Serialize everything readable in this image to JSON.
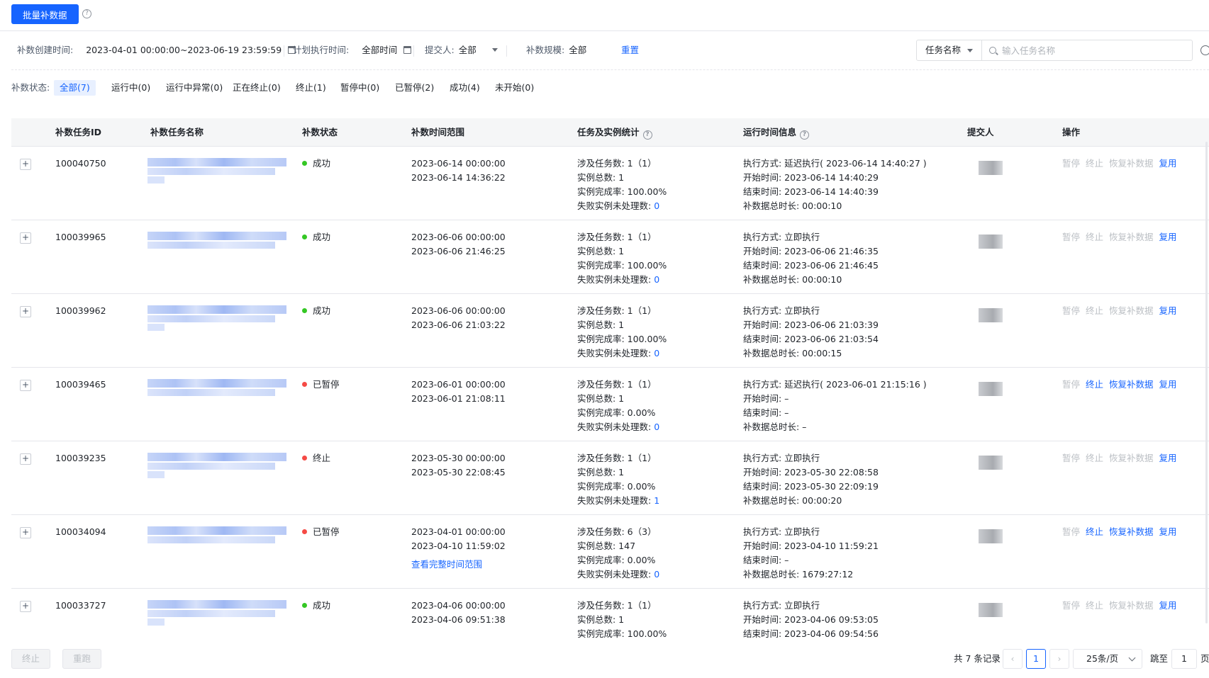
{
  "toolbar": {
    "batch_button": "批量补数据",
    "help_icon": "?"
  },
  "filters": {
    "created_label": "补数创建时间:",
    "created_value": "2023-04-01 00:00:00~2023-06-19 23:59:59",
    "plan_label": "计划执行时间:",
    "plan_value": "全部时间",
    "submitter_label": "提交人:",
    "submitter_value": "全部",
    "scale_label": "补数规模:",
    "scale_value": "全部",
    "reset": "重置",
    "search_field": "任务名称",
    "search_placeholder": "输入任务名称"
  },
  "status_filter": {
    "label": "补数状态:",
    "tabs": [
      "全部(7)",
      "运行中(0)",
      "运行中异常(0)",
      "正在终止(0)",
      "终止(1)",
      "暂停中(0)",
      "已暂停(2)",
      "成功(4)",
      "未开始(0)"
    ],
    "active": "全部(7)"
  },
  "table": {
    "headers": [
      "补数任务ID",
      "补数任务名称",
      "补数状态",
      "补数时间范围",
      "任务及实例统计",
      "运行时间信息",
      "提交人",
      "操作"
    ],
    "expand_symbol": "+",
    "rows": [
      {
        "id": "100040750",
        "status": "成功",
        "status_color": "#34c724",
        "range_start": "2023-06-14 00:00:00",
        "range_end": "2023-06-14 14:36:22",
        "range_link": "",
        "tasks": "涉及任务数: 1（1）",
        "instances": "实例总数: 1",
        "rate": "实例完成率: 100.00%",
        "failed_label": "失败实例未处理数: ",
        "failed_count": "0",
        "exec_mode": "执行方式: 延迟执行( 2023-06-14 14:40:27 )",
        "start": "开始时间: 2023-06-14 14:40:29",
        "end": "结束时间: 2023-06-14 14:40:39",
        "duration": "补数据总时长: 00:00:10",
        "ops": {
          "pause": "暂停",
          "stop": "终止",
          "resume": "恢复补数据",
          "reuse": "复用"
        },
        "ops_state": {
          "pause": false,
          "stop": false,
          "resume": false,
          "reuse": true
        }
      },
      {
        "id": "100039965",
        "status": "成功",
        "status_color": "#34c724",
        "range_start": "2023-06-06 00:00:00",
        "range_end": "2023-06-06 21:46:25",
        "range_link": "",
        "tasks": "涉及任务数: 1（1）",
        "instances": "实例总数: 1",
        "rate": "实例完成率: 100.00%",
        "failed_label": "失败实例未处理数: ",
        "failed_count": "0",
        "exec_mode": "执行方式: 立即执行",
        "start": "开始时间: 2023-06-06 21:46:35",
        "end": "结束时间: 2023-06-06 21:46:45",
        "duration": "补数据总时长: 00:00:10",
        "ops": {
          "pause": "暂停",
          "stop": "终止",
          "resume": "恢复补数据",
          "reuse": "复用"
        },
        "ops_state": {
          "pause": false,
          "stop": false,
          "resume": false,
          "reuse": true
        }
      },
      {
        "id": "100039962",
        "status": "成功",
        "status_color": "#34c724",
        "range_start": "2023-06-06 00:00:00",
        "range_end": "2023-06-06 21:03:22",
        "range_link": "",
        "tasks": "涉及任务数: 1（1）",
        "instances": "实例总数: 1",
        "rate": "实例完成率: 100.00%",
        "failed_label": "失败实例未处理数: ",
        "failed_count": "0",
        "exec_mode": "执行方式: 立即执行",
        "start": "开始时间: 2023-06-06 21:03:39",
        "end": "结束时间: 2023-06-06 21:03:54",
        "duration": "补数据总时长: 00:00:15",
        "ops": {
          "pause": "暂停",
          "stop": "终止",
          "resume": "恢复补数据",
          "reuse": "复用"
        },
        "ops_state": {
          "pause": false,
          "stop": false,
          "resume": false,
          "reuse": true
        }
      },
      {
        "id": "100039465",
        "status": "已暂停",
        "status_color": "#f54a45",
        "range_start": "2023-06-01 00:00:00",
        "range_end": "2023-06-01 21:08:11",
        "range_link": "",
        "tasks": "涉及任务数: 1（1）",
        "instances": "实例总数: 1",
        "rate": "实例完成率: 0.00%",
        "failed_label": "失败实例未处理数: ",
        "failed_count": "0",
        "exec_mode": "执行方式: 延迟执行( 2023-06-01 21:15:16 )",
        "start": "开始时间: –",
        "end": "结束时间: –",
        "duration": "补数据总时长: –",
        "ops": {
          "pause": "暂停",
          "stop": "终止",
          "resume": "恢复补数据",
          "reuse": "复用"
        },
        "ops_state": {
          "pause": false,
          "stop": true,
          "resume": true,
          "reuse": true
        }
      },
      {
        "id": "100039235",
        "status": "终止",
        "status_color": "#f54a45",
        "range_start": "2023-05-30 00:00:00",
        "range_end": "2023-05-30 22:08:45",
        "range_link": "",
        "tasks": "涉及任务数: 1（1）",
        "instances": "实例总数: 1",
        "rate": "实例完成率: 0.00%",
        "failed_label": "失败实例未处理数: ",
        "failed_count": "1",
        "exec_mode": "执行方式: 立即执行",
        "start": "开始时间: 2023-05-30 22:08:58",
        "end": "结束时间: 2023-05-30 22:09:19",
        "duration": "补数据总时长: 00:00:20",
        "ops": {
          "pause": "暂停",
          "stop": "终止",
          "resume": "恢复补数据",
          "reuse": "复用"
        },
        "ops_state": {
          "pause": false,
          "stop": false,
          "resume": false,
          "reuse": true
        }
      },
      {
        "id": "100034094",
        "status": "已暂停",
        "status_color": "#f54a45",
        "range_start": "2023-04-01 00:00:00",
        "range_end": "2023-04-10 11:59:02",
        "range_link": "查看完整时间范围",
        "tasks": "涉及任务数: 6（3）",
        "instances": "实例总数: 147",
        "rate": "实例完成率: 0.00%",
        "failed_label": "失败实例未处理数: ",
        "failed_count": "0",
        "exec_mode": "执行方式: 立即执行",
        "start": "开始时间: 2023-04-10 11:59:21",
        "end": "结束时间: –",
        "duration": "补数据总时长: 1679:27:12",
        "ops": {
          "pause": "暂停",
          "stop": "终止",
          "resume": "恢复补数据",
          "reuse": "复用"
        },
        "ops_state": {
          "pause": false,
          "stop": true,
          "resume": true,
          "reuse": true
        }
      },
      {
        "id": "100033727",
        "status": "成功",
        "status_color": "#34c724",
        "range_start": "2023-04-06 00:00:00",
        "range_end": "2023-04-06 09:51:38",
        "range_link": "",
        "tasks": "涉及任务数: 1（1）",
        "instances": "实例总数: 1",
        "rate": "实例完成率: 100.00%",
        "failed_label": "",
        "failed_count": "",
        "exec_mode": "执行方式: 立即执行",
        "start": "开始时间: 2023-04-06 09:53:05",
        "end": "结束时间: 2023-04-06 09:54:56",
        "duration": "",
        "ops": {
          "pause": "暂停",
          "stop": "终止",
          "resume": "恢复补数据",
          "reuse": "复用"
        },
        "ops_state": {
          "pause": false,
          "stop": false,
          "resume": false,
          "reuse": true
        }
      }
    ]
  },
  "bottom": {
    "stop_button": "终止",
    "rerun_button": "重跑",
    "total": "共 7 条记录",
    "prev": "‹",
    "current_page": "1",
    "next": "›",
    "page_size": "25条/页",
    "jump_label": "跳至",
    "jump_value": "1",
    "page_suffix": "页"
  },
  "colors": {
    "primary": "#1664ff",
    "success": "#34c724",
    "danger": "#f54a45"
  }
}
